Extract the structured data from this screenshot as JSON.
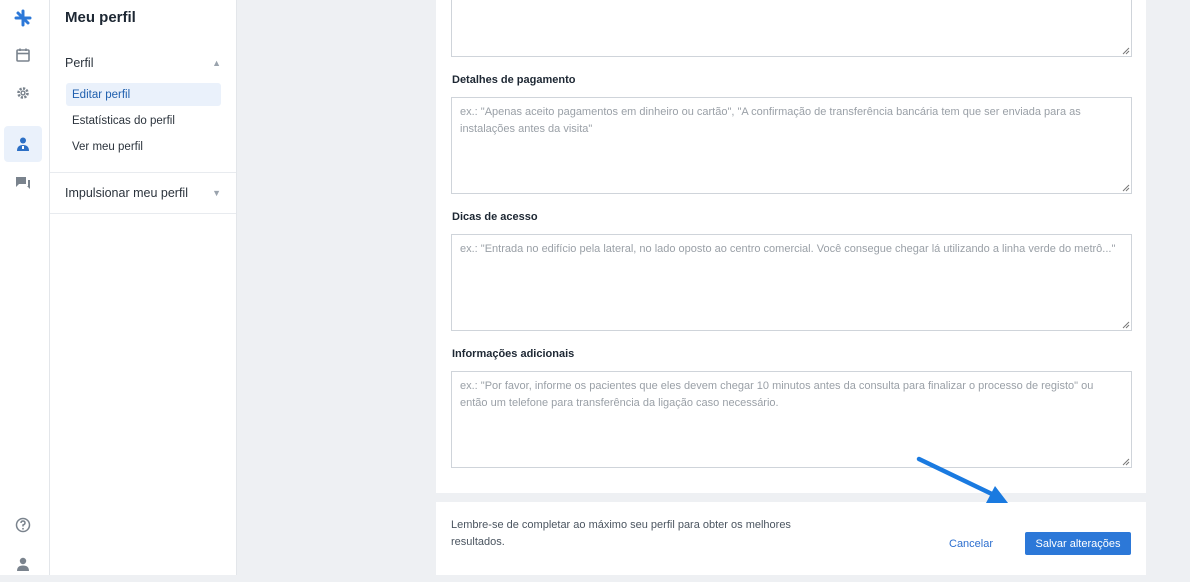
{
  "sidebar": {
    "title": "Meu perfil",
    "sections": [
      {
        "label": "Perfil",
        "items": [
          {
            "label": "Editar perfil"
          },
          {
            "label": "Estatísticas do perfil"
          },
          {
            "label": "Ver meu perfil"
          }
        ]
      },
      {
        "label": "Impulsionar meu perfil"
      }
    ]
  },
  "form": {
    "payment": {
      "label": "Detalhes de pagamento",
      "placeholder": "ex.: \"Apenas aceito pagamentos em dinheiro ou cartão\", \"A confirmação de transferência bancária tem que ser enviada para as instalações antes da visita\""
    },
    "access": {
      "label": "Dicas de acesso",
      "placeholder": "ex.: \"Entrada no edifício pela lateral, no lado oposto ao centro comercial. Você consegue chegar lá utilizando a linha verde do metrô...\""
    },
    "additional": {
      "label": "Informações adicionais",
      "placeholder": "ex.: \"Por favor, informe os pacientes que eles devem chegar 10 minutos antes da consulta para finalizar o processo de registo\" ou então um telefone para transferência da ligação caso necessário."
    }
  },
  "footer": {
    "reminder": "Lembre-se de completar ao máximo seu perfil para obter os melhores resultados.",
    "cancel_label": "Cancelar",
    "save_label": "Salvar alterações"
  },
  "icons": {
    "rail": [
      "logo-icon",
      "calendar-icon",
      "settings-gear-icon",
      "profile-doctor-icon",
      "messages-icon",
      "help-icon",
      "user-account-icon"
    ],
    "annotation": "blue-arrow-icon"
  },
  "colors": {
    "accent": "#2c78d8",
    "active_bg": "#eaf1fb",
    "background": "#eef0f3"
  }
}
